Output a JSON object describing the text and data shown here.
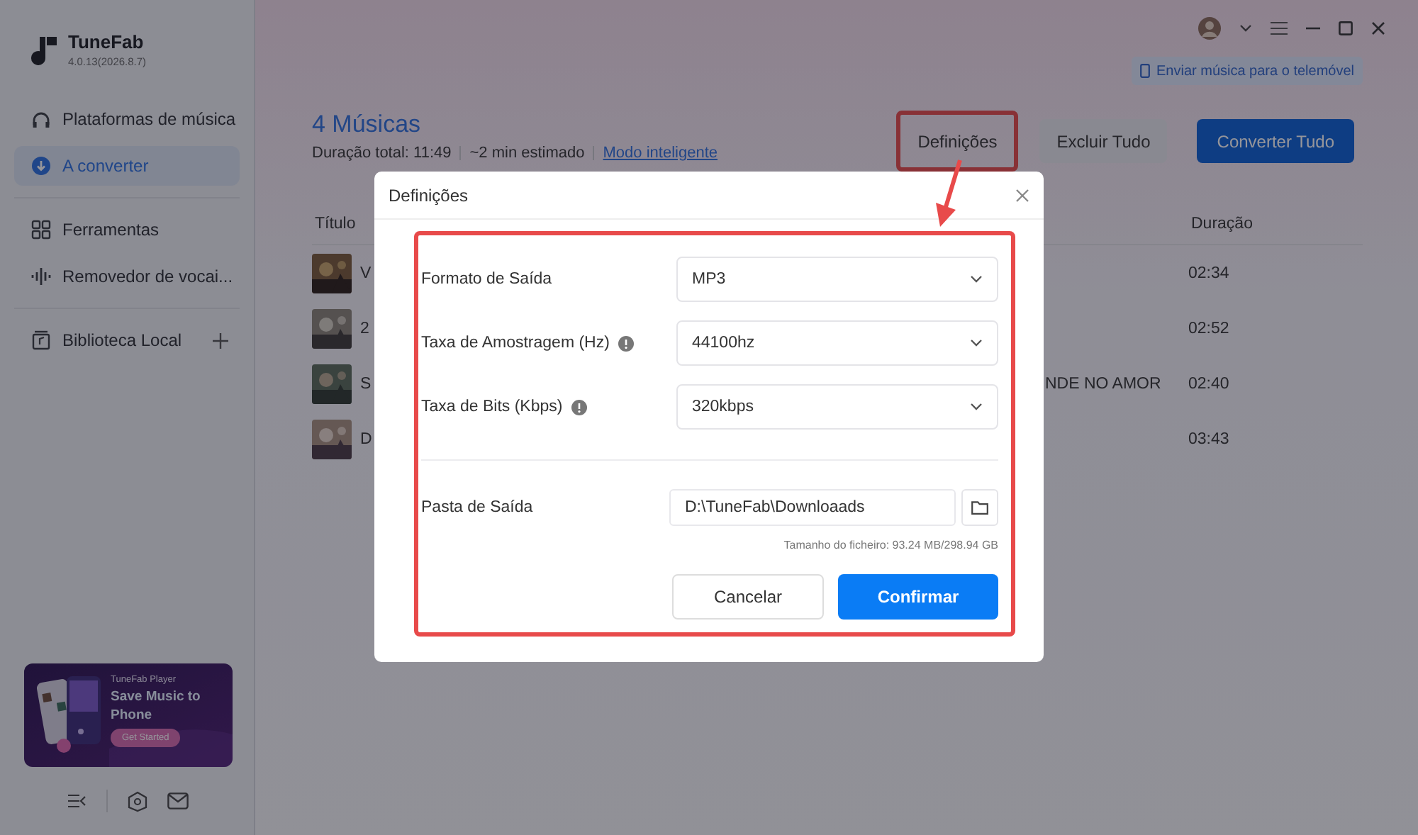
{
  "app": {
    "name": "TuneFab",
    "version": "4.0.13(2026.8.7)"
  },
  "sidebar": {
    "groups": [
      [
        {
          "label": "Plataformas de música",
          "selected": false
        },
        {
          "label": "A converter",
          "selected": true
        }
      ],
      [
        {
          "label": "Ferramentas",
          "selected": false
        },
        {
          "label": "Removedor de vocai...",
          "selected": false
        }
      ],
      [
        {
          "label": "Biblioteca Local",
          "selected": false
        }
      ]
    ]
  },
  "promo": {
    "kicker": "TuneFab Player",
    "headline": "Save Music to Phone",
    "button": "Get Started"
  },
  "send_to_phone": "Enviar música para o telemóvel",
  "header": {
    "title": "4 Músicas",
    "total": "Duração total: 11:49",
    "estimate": "~2 min estimado",
    "smart_mode": "Modo inteligente"
  },
  "buttons": [
    {
      "label": "Definições",
      "kind": "plain",
      "highlighted": true
    },
    {
      "label": "Excluir Tudo",
      "kind": "secondary",
      "highlighted": false
    },
    {
      "label": "Converter Tudo",
      "kind": "primary",
      "highlighted": false
    }
  ],
  "table": {
    "columns": [
      "Título",
      "Duração"
    ],
    "rows": [
      {
        "title": "V",
        "duration": "02:34"
      },
      {
        "title": "2",
        "duration": "02:52"
      },
      {
        "title": "S",
        "column_3": "NDE NO AMOR",
        "duration": "02:40"
      },
      {
        "title": "D",
        "duration": "03:43"
      }
    ]
  },
  "dialog": {
    "title": "Definições",
    "highlighted": true,
    "fields": [
      {
        "label": "Formato de Saída",
        "info": false,
        "value": "MP3"
      },
      {
        "label": "Taxa de Amostragem (Hz)",
        "info": true,
        "value": "44100hz"
      },
      {
        "label": "Taxa de Bits (Kbps)",
        "info": true,
        "value": "320kbps"
      }
    ],
    "output_folder": {
      "label": "Pasta de Saída",
      "value": "D:\\TuneFab\\Downloaads"
    },
    "size_note": "Tamanho do ficheiro: 93.24 MB/298.94 GB",
    "buttons": [
      {
        "label": "Cancelar",
        "kind": "secondary"
      },
      {
        "label": "Confirmar",
        "kind": "primary"
      }
    ]
  }
}
